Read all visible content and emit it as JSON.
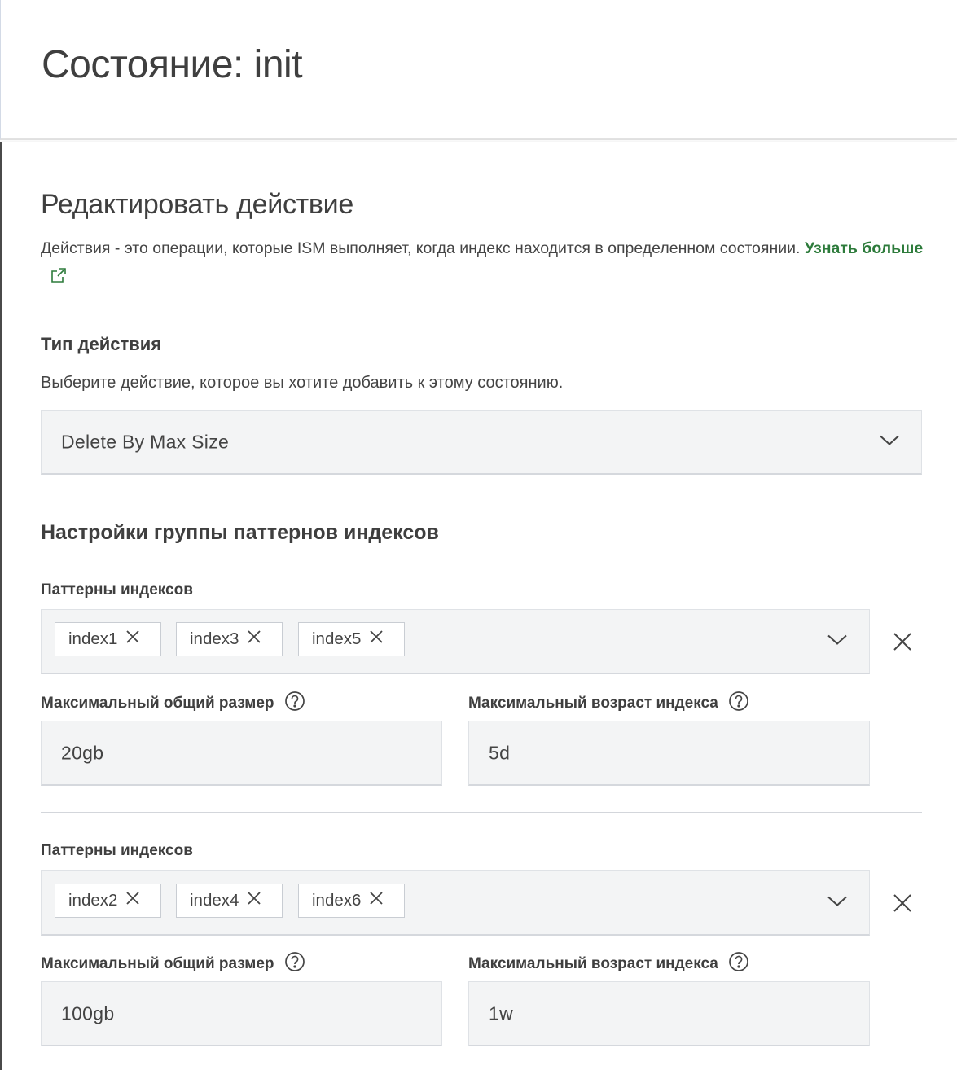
{
  "header": {
    "title": "Состояние: init"
  },
  "flyout": {
    "title": "Редактировать действие",
    "description": "Действия - это операции, которые ISM выполняет, когда индекс находится в определенном состоянии.",
    "learn_more": "Узнать больше"
  },
  "action_type": {
    "label": "Тип действия",
    "help": "Выберите действие, которое вы хотите добавить к этому состоянию.",
    "selected": "Delete By Max Size"
  },
  "groups_section": {
    "title": "Настройки группы паттернов индексов"
  },
  "groups": [
    {
      "patterns_label": "Паттерны индексов",
      "patterns": [
        "index1",
        "index3",
        "index5"
      ],
      "max_size_label": "Максимальный общий размер",
      "max_size": "20gb",
      "max_age_label": "Максимальный возраст индекса",
      "max_age": "5d"
    },
    {
      "patterns_label": "Паттерны индексов",
      "patterns": [
        "index2",
        "index4",
        "index6"
      ],
      "max_size_label": "Максимальный общий размер",
      "max_size": "100gb",
      "max_age_label": "Максимальный возраст индекса",
      "max_age": "1w"
    }
  ],
  "icons": {
    "external_link": "external-link-icon",
    "chevron": "chevron-down-icon",
    "remove": "close-icon",
    "help": "question-circle-icon"
  },
  "colors": {
    "link": "#2d7b3b",
    "field_bg": "#f3f4f5",
    "text": "#3f3f3f"
  }
}
